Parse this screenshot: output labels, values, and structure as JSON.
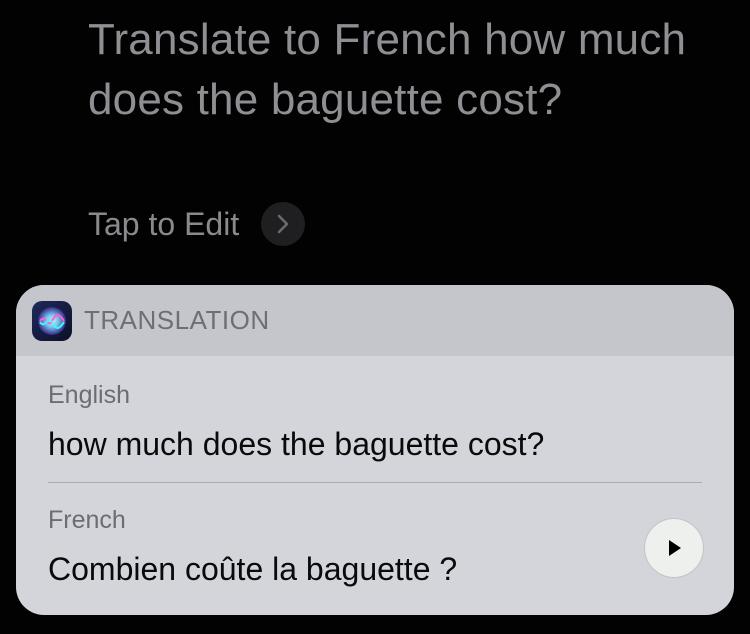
{
  "query": {
    "text": "Translate to French how much does the baguette cost?",
    "edit_label": "Tap to Edit"
  },
  "card": {
    "app_name": "TRANSLATION",
    "app_icon": "siri-icon",
    "source": {
      "language": "English",
      "text": "how much does the baguette cost?"
    },
    "target": {
      "language": "French",
      "text": "Combien coûte la baguette ?"
    },
    "play_icon": "play-icon"
  },
  "colors": {
    "background": "#020202",
    "query_text": "#8e8e93",
    "card_body": "#d3d5db",
    "card_header": "#c4c6cb"
  }
}
